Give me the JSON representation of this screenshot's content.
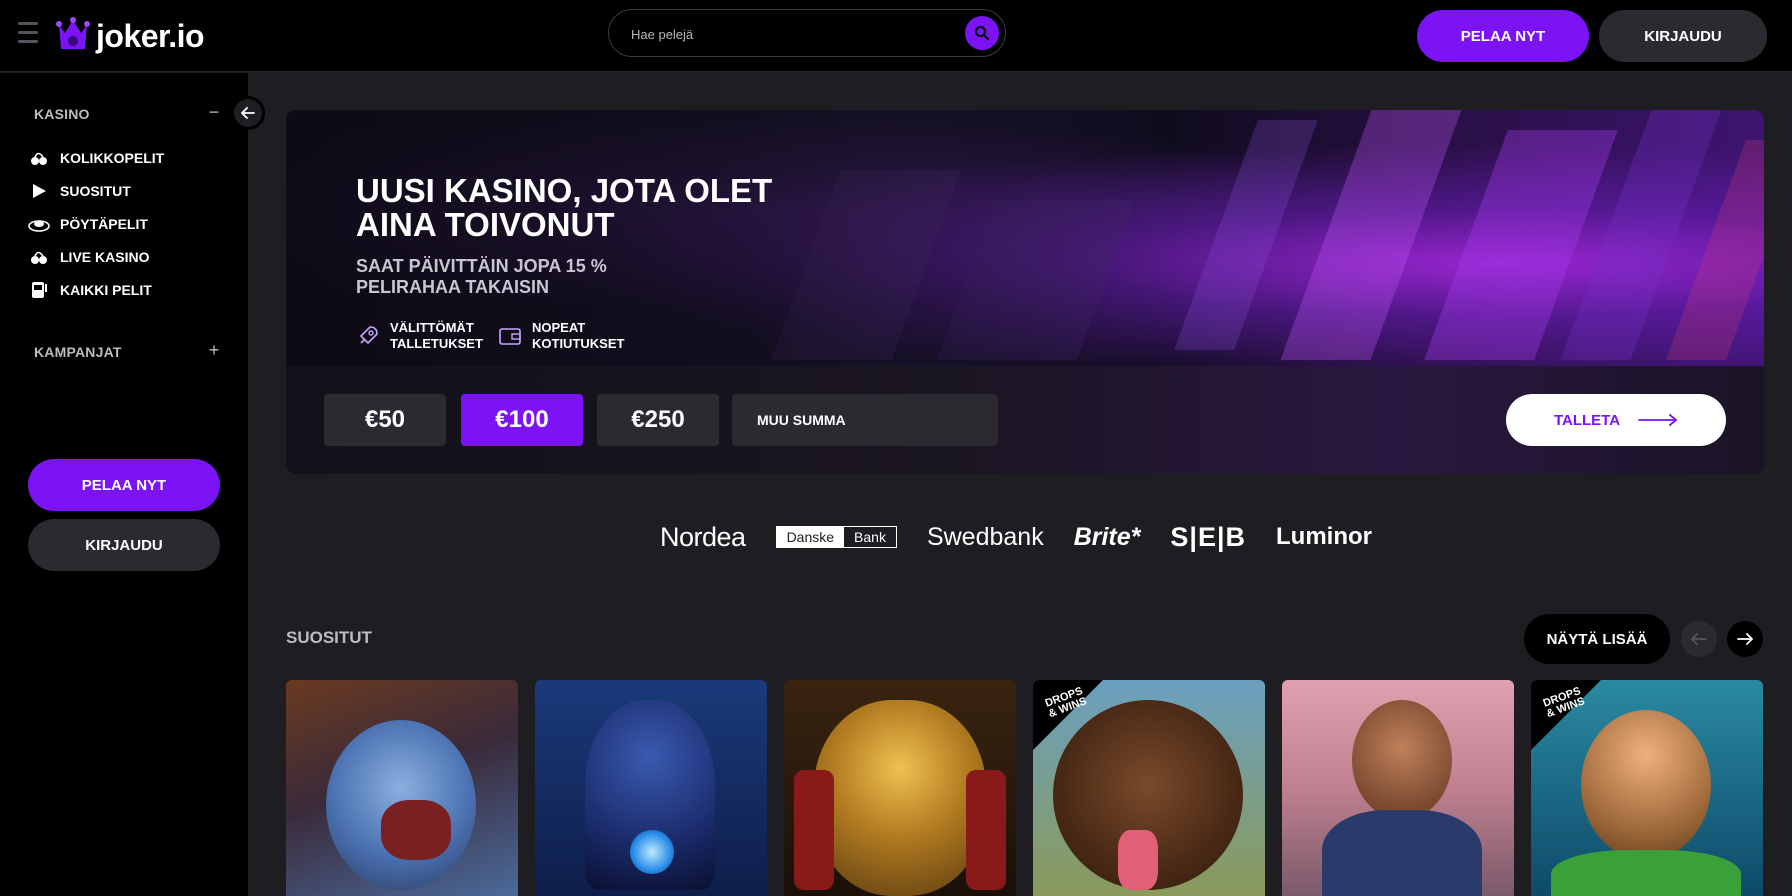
{
  "header": {
    "logo_text": "joker.io",
    "search_placeholder": "Hae pelejä",
    "play_label": "PELAA NYT",
    "login_label": "KIRJAUDU"
  },
  "sidebar": {
    "casino_heading": "KASINO",
    "casino_toggle": "−",
    "items": [
      {
        "label": "KOLIKKOPELIT",
        "icon": "cherries-icon"
      },
      {
        "label": "SUOSITUT",
        "icon": "play-icon"
      },
      {
        "label": "PÖYTÄPELIT",
        "icon": "roulette-icon"
      },
      {
        "label": "LIVE KASINO",
        "icon": "cherries-icon"
      },
      {
        "label": "KAIKKI PELIT",
        "icon": "slot-machine-icon"
      }
    ],
    "campaigns_heading": "KAMPANJAT",
    "campaigns_toggle": "+",
    "play_label": "PELAA NYT",
    "login_label": "KIRJAUDU"
  },
  "hero": {
    "title": "UUSI KASINO, JOTA OLET AINA TOIVONUT",
    "subtitle": "SAAT PÄIVITTÄIN JOPA 15 % PELIRAHAA TAKAISIN",
    "features": [
      {
        "label": "VÄLITTÖMÄT TALLETUKSET",
        "icon": "rocket-icon"
      },
      {
        "label": "NOPEAT KOTIUTUKSET",
        "icon": "wallet-icon"
      }
    ],
    "amounts": [
      "€50",
      "€100",
      "€250"
    ],
    "selected_amount": "€100",
    "other_amount": "MUU SUMMA",
    "deposit_label": "TALLETA"
  },
  "banks": {
    "nordea": "Nordea",
    "danske_left": "Danske",
    "danske_right": "Bank",
    "swedbank": "Swedbank",
    "brite": "Brite*",
    "seb": "S|E|B",
    "luminor": "Luminor"
  },
  "popular": {
    "title": "SUOSITUT",
    "more_label": "NÄYTÄ LISÄÄ",
    "drops_wins": "DROPS & WINS"
  },
  "colors": {
    "accent": "#7b13f5",
    "background": "#1e1d22",
    "sidebar": "#000000"
  }
}
